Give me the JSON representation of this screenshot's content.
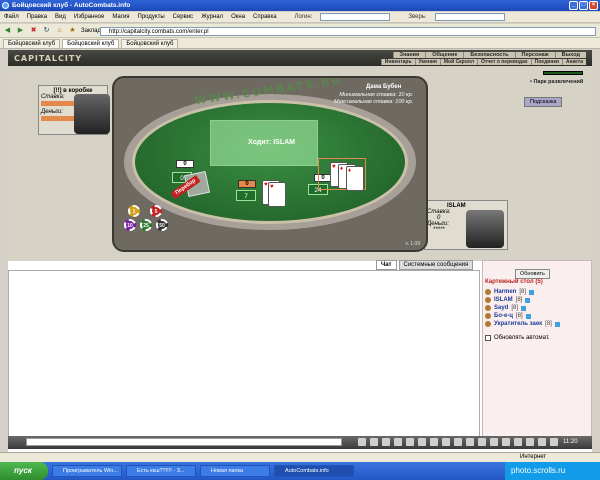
{
  "window": {
    "title": "Бойцовский клуб - AutoCombats.info"
  },
  "menu": {
    "items": [
      "Файл",
      "Правка",
      "Вид",
      "Избранное",
      "Магия",
      "Продукты",
      "Сервис",
      "Журнал",
      "Окна",
      "Справка"
    ],
    "login_label": "Логин:",
    "beast_label": "Зверь:"
  },
  "toolbar": {
    "bookmarks": "Закладки",
    "address": "http://capitalcity.combats.com/enter.pl"
  },
  "tabs": [
    "Бойцовский клуб",
    "Бойцовский клуб",
    "Бойцовский клуб"
  ],
  "site": {
    "logo": "CAPITALCITY",
    "nav_top": [
      "Знания",
      "Общение",
      "Безопасность",
      "Персонаж",
      "Выход"
    ],
    "nav_bottom": [
      "Инвентарь",
      "Умения",
      "Мой Скролл",
      "Отчет о переводах",
      "Поединки",
      "Анкета"
    ],
    "park": "• Парк развлечений",
    "hint_button": "Подсказка"
  },
  "game": {
    "left_player": {
      "name": "[!!] в коробке",
      "stake_label": "Ставка:",
      "money_label": "Деньги:"
    },
    "right_player": {
      "name": "ISLAM",
      "stake_label": "Ставка:",
      "stake_value": "0",
      "money_label": "Деньги:",
      "money_value": "*****"
    },
    "site_text": "WWW.COMBATS.RU",
    "dealer": "Дама Бубен",
    "min_stake_label": "Минимальная ставка:",
    "min_stake_value": "10 кр.",
    "max_stake_label": "Максимальная ставка:",
    "max_stake_value": "100 кр.",
    "turn": "Ходит: ISLAM",
    "left_chip": "0",
    "left_score": "0",
    "mid_chip": "0",
    "mid_score": "7",
    "right_chip": "0",
    "right_score": "24",
    "bust": "Перебор",
    "chips": [
      "1",
      "5",
      "10",
      "25",
      "50"
    ],
    "version": "v. 1.09"
  },
  "chat": {
    "tab_chat": "Чат",
    "tab_system": "Системные сообщения"
  },
  "sidebar": {
    "refresh": "Обновить",
    "room": "Картежный стол (5)",
    "players": [
      {
        "name": "Harmen",
        "level": "[8]"
      },
      {
        "name": "ISLAM",
        "level": "[8]"
      },
      {
        "name": "Sayd",
        "level": "[8]"
      },
      {
        "name": "Бо-е-ц",
        "level": "[8]"
      },
      {
        "name": "Укратитель заек",
        "level": "[8]"
      }
    ],
    "auto_refresh": "Обновлять автомат."
  },
  "bottom": {
    "time": "11:20"
  },
  "status": {
    "internet": "Интернет"
  },
  "taskbar": {
    "start": "пуск",
    "tasks": [
      "Проигрыватель Win...",
      "Есть ккш??!!!! - З...",
      "Новая папка",
      "AutoCombats.info"
    ],
    "watermark": "photo.scrolls.ru"
  }
}
